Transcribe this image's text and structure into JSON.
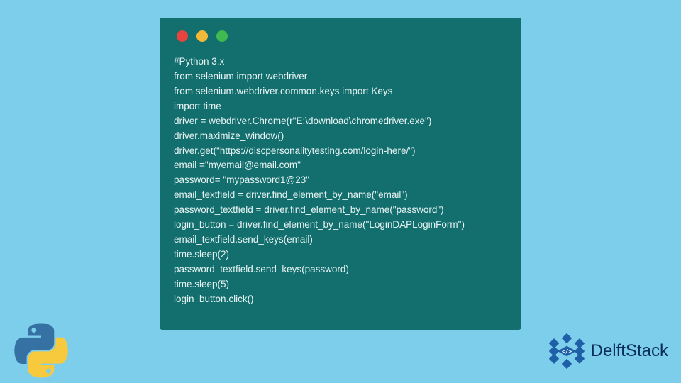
{
  "code": {
    "lines": [
      "#Python 3.x",
      "from selenium import webdriver",
      "from selenium.webdriver.common.keys import Keys",
      "import time",
      "driver = webdriver.Chrome(r\"E:\\download\\chromedriver.exe\")",
      "driver.maximize_window()",
      "driver.get(\"https://discpersonalitytesting.com/login-here/\")",
      "email =\"myemail@email.com\"",
      "password= \"mypassword1@23\"",
      "email_textfield = driver.find_element_by_name(\"email\")",
      "password_textfield = driver.find_element_by_name(\"password\")",
      "login_button = driver.find_element_by_name(\"LoginDAPLoginForm\")",
      "email_textfield.send_keys(email)",
      "time.sleep(2)",
      "password_textfield.send_keys(password)",
      "time.sleep(5)",
      "login_button.click()"
    ]
  },
  "brand": {
    "name": "DelftStack"
  },
  "colors": {
    "background": "#7dceeb",
    "window": "#136e6e",
    "text": "#e8f4f4",
    "brand_text": "#0a2e5c"
  }
}
